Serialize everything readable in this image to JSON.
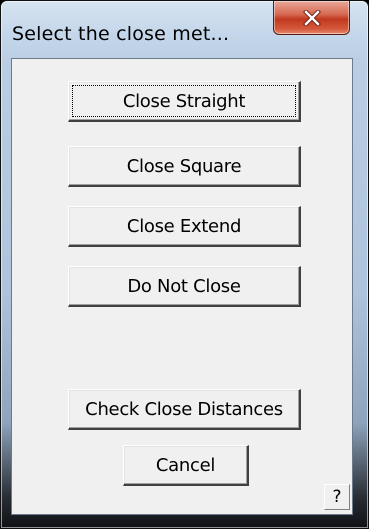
{
  "window": {
    "title": "Select the close met..."
  },
  "buttons": {
    "close_straight": "Close Straight",
    "close_square": "Close Square",
    "close_extend": "Close Extend",
    "do_not_close": "Do Not Close",
    "check_close_distances": "Check Close Distances",
    "cancel": "Cancel",
    "help": "?"
  },
  "icons": {
    "close": "close-icon"
  },
  "colors": {
    "close_button": "#c0391e",
    "dialog_face": "#f0f0f0",
    "frame": "#b9cde3"
  }
}
